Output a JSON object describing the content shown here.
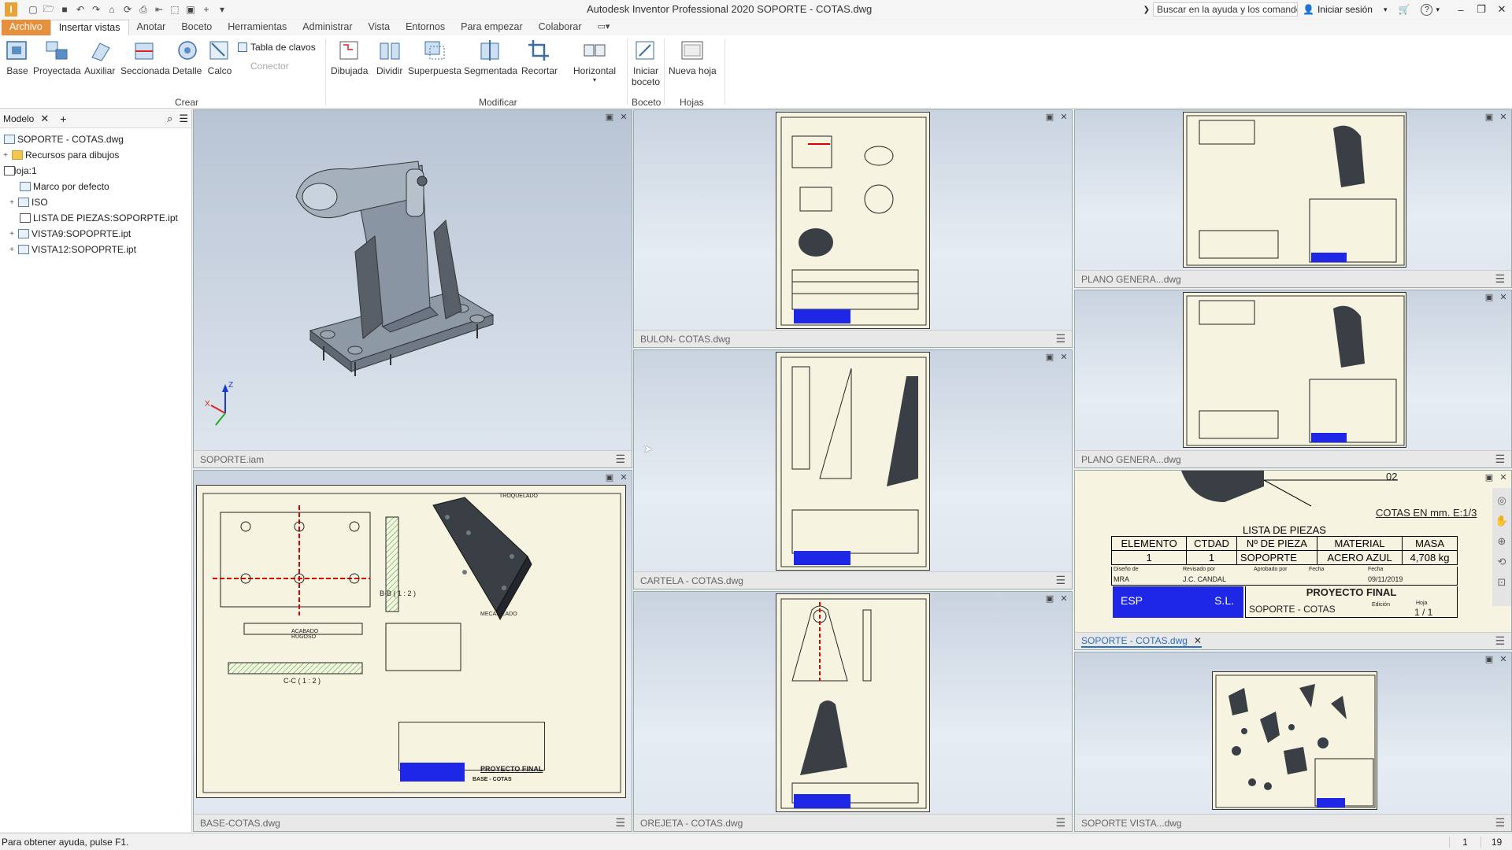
{
  "app": {
    "title": "Autodesk Inventor Professional 2020   SOPORTE - COTAS.dwg",
    "logo_letter": "I",
    "search_placeholder": "Buscar en la ayuda y los comandos",
    "signin_label": "Iniciar sesión",
    "help_icon": "?"
  },
  "ribbon": {
    "tabs": [
      "Archivo",
      "Insertar vistas",
      "Anotar",
      "Boceto",
      "Herramientas",
      "Administrar",
      "Vista",
      "Entornos",
      "Para empezar",
      "Colaborar"
    ],
    "active_tab": "Insertar vistas",
    "crear": {
      "label": "Crear",
      "buttons": [
        "Base",
        "Proyectada",
        "Auxiliar",
        "Seccionada",
        "Detalle",
        "Calco"
      ],
      "small": [
        "Tabla de clavos",
        "Conector"
      ]
    },
    "modificar": {
      "label": "Modificar",
      "buttons": [
        "Dibujada",
        "Dividir",
        "Superpuesta",
        "Segmentada",
        "Recortar",
        "Horizontal"
      ]
    },
    "boceto": {
      "label": "Boceto",
      "button_line1": "Iniciar",
      "button_line2": "boceto"
    },
    "hojas": {
      "label": "Hojas",
      "button": "Nueva hoja"
    }
  },
  "browser": {
    "tab_label": "Modelo",
    "items": [
      {
        "label": "SOPORTE - COTAS.dwg",
        "indent": 0,
        "expander": ""
      },
      {
        "label": "Recursos para dibujos",
        "indent": 1,
        "expander": "+"
      },
      {
        "label": "Hoja:1",
        "indent": 1,
        "expander": "−"
      },
      {
        "label": "Marco por defecto",
        "indent": 2,
        "expander": ""
      },
      {
        "label": "ISO",
        "indent": 2,
        "expander": "+"
      },
      {
        "label": "LISTA DE PIEZAS:SOPORPTE.ipt",
        "indent": 2,
        "expander": ""
      },
      {
        "label": "VISTA9:SOPOPRTE.ipt",
        "indent": 2,
        "expander": "+"
      },
      {
        "label": "VISTA12:SOPOPRTE.ipt",
        "indent": 2,
        "expander": "+"
      }
    ]
  },
  "viewports": {
    "assembly": "SOPORTE.iam",
    "base": "BASE-COTAS.dwg",
    "bulon": "BULON- COTAS.dwg",
    "cartela": "CARTELA - COTAS.dwg",
    "orejeta": "OREJETA - COTAS.dwg",
    "plano1": "PLANO GENERA...dwg",
    "plano2": "PLANO GENERA...dwg",
    "soporte_active": "SOPORTE - COTAS.dwg",
    "soporte_vista": "SOPORTE VISTA...dwg"
  },
  "drawing": {
    "scale_note": "COTAS EN mm. E:1/3",
    "bom_title": "LISTA DE PIEZAS",
    "bom_headers": [
      "ELEMENTO",
      "CTDAD",
      "Nº DE PIEZA",
      "MATERIAL",
      "MASA"
    ],
    "bom_row": [
      "1",
      "1",
      "SOPOPRTE",
      "ACERO AZUL",
      "4,708 kg"
    ],
    "tb_row1": [
      "Diseño de",
      "Revisado por",
      "Aprobado por",
      "Fecha",
      "Fecha"
    ],
    "tb_row2": [
      "MRA",
      "J.C. CANDAL",
      "",
      "",
      "09/11/2019"
    ],
    "project": "PROYECTO FINAL",
    "part": "SOPORTE - COTAS",
    "company_left": "ESP",
    "company_right": "S.L.",
    "edition_label": "Edición",
    "sheet_label": "Hoja",
    "sheet_value": "1 / 1",
    "balloon": "02",
    "base_views": {
      "section_bb": "B-B ( 1 : 2 )",
      "section_cc": "C-C ( 1 : 2 )",
      "title": "PROYECTO FINAL",
      "part": "BASE - COTAS",
      "troquelado": "TROQUELADO",
      "mecanizado": "MECANIZADO",
      "acabado": "ACABADO RUGOSO"
    }
  },
  "status": {
    "help": "Para obtener ayuda, pulse F1.",
    "n1": "1",
    "n2": "19"
  },
  "colors": {
    "accent_orange": "#e5903c",
    "title_block_blue": "#1e27e6",
    "sheet_bg": "#f6f3e0",
    "active_tab_blue": "#2d6fbe"
  }
}
